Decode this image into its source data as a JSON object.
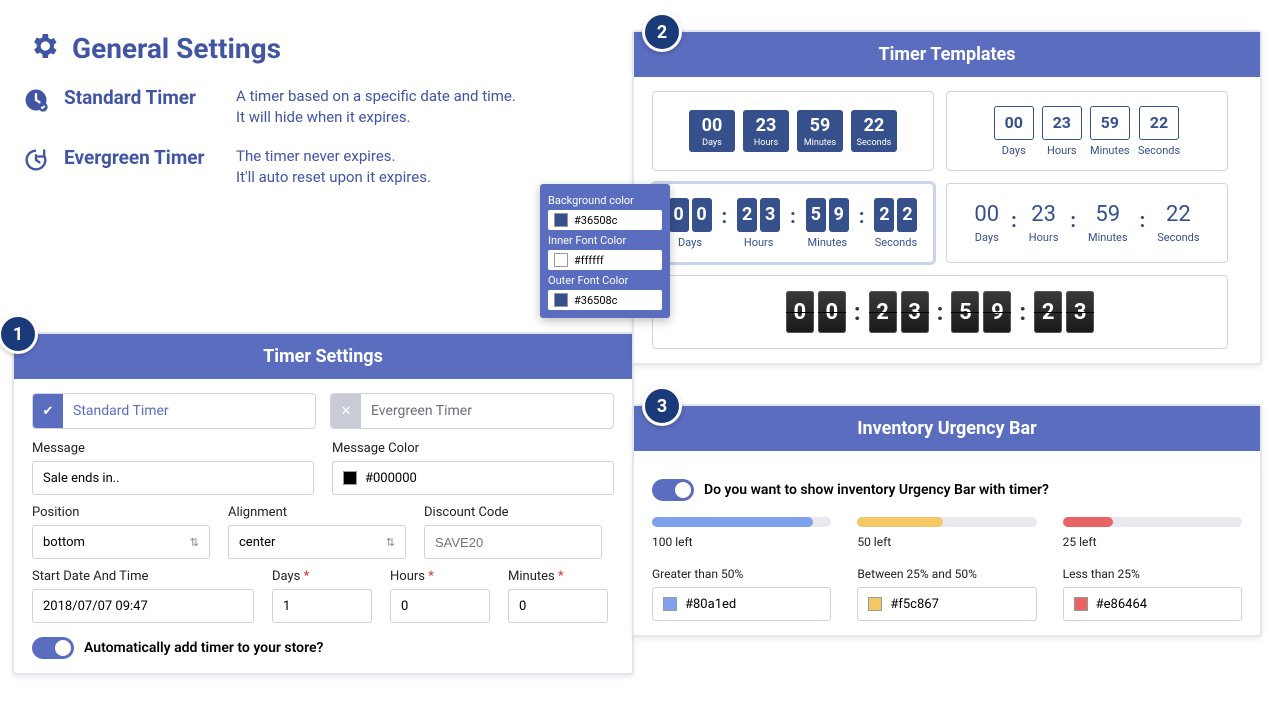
{
  "page": {
    "title": "General Settings"
  },
  "timer_types": {
    "standard": {
      "name": "Standard Timer",
      "desc_line1": "A timer based on a specific date and time.",
      "desc_line2": "It will hide when it expires."
    },
    "evergreen": {
      "name": "Evergreen Timer",
      "desc_line1": "The timer never expires.",
      "desc_line2": "It'll auto reset upon it expires."
    }
  },
  "steps": {
    "settings": "1",
    "templates": "2",
    "urgency": "3"
  },
  "settings_panel": {
    "title": "Timer Settings",
    "tab_standard": "Standard Timer",
    "tab_evergreen": "Evergreen Timer",
    "fields": {
      "message_label": "Message",
      "message_value": "Sale ends in..",
      "message_color_label": "Message Color",
      "message_color_value": "#000000",
      "position_label": "Position",
      "position_value": "bottom",
      "alignment_label": "Alignment",
      "alignment_value": "center",
      "discount_label": "Discount Code",
      "discount_placeholder": "SAVE20",
      "start_label": "Start Date And Time",
      "start_value": "2018/07/07 09:47",
      "days_label": "Days",
      "days_value": "1",
      "hours_label": "Hours",
      "hours_value": "0",
      "minutes_label": "Minutes",
      "minutes_value": "0"
    },
    "auto_add_toggle": "Automatically add timer to your store?"
  },
  "templates_panel": {
    "title": "Timer Templates",
    "counter": {
      "days": "00",
      "hours": "23",
      "minutes": "59",
      "seconds": "22"
    },
    "counter_alt_sec": "23",
    "labels": {
      "days": "Days",
      "hours": "Hours",
      "minutes": "Minutes",
      "seconds": "Seconds"
    }
  },
  "color_popup": {
    "bg_label": "Background color",
    "bg_value": "#36508c",
    "inner_label": "Inner Font Color",
    "inner_value": "#ffffff",
    "outer_label": "Outer Font Color",
    "outer_value": "#36508c"
  },
  "urgency_panel": {
    "title": "Inventory Urgency Bar",
    "toggle_label": "Do you want to show inventory Urgency Bar with timer?",
    "bars": [
      {
        "label": "100 left",
        "pct": 90,
        "color": "#80a1ed"
      },
      {
        "label": "50 left",
        "pct": 48,
        "color": "#f5c867"
      },
      {
        "label": "25 left",
        "pct": 28,
        "color": "#e86464"
      }
    ],
    "rules": [
      {
        "label": "Greater than 50%",
        "color": "#80a1ed"
      },
      {
        "label": "Between 25% and 50%",
        "color": "#f5c867"
      },
      {
        "label": "Less than 25%",
        "color": "#e86464"
      }
    ]
  }
}
